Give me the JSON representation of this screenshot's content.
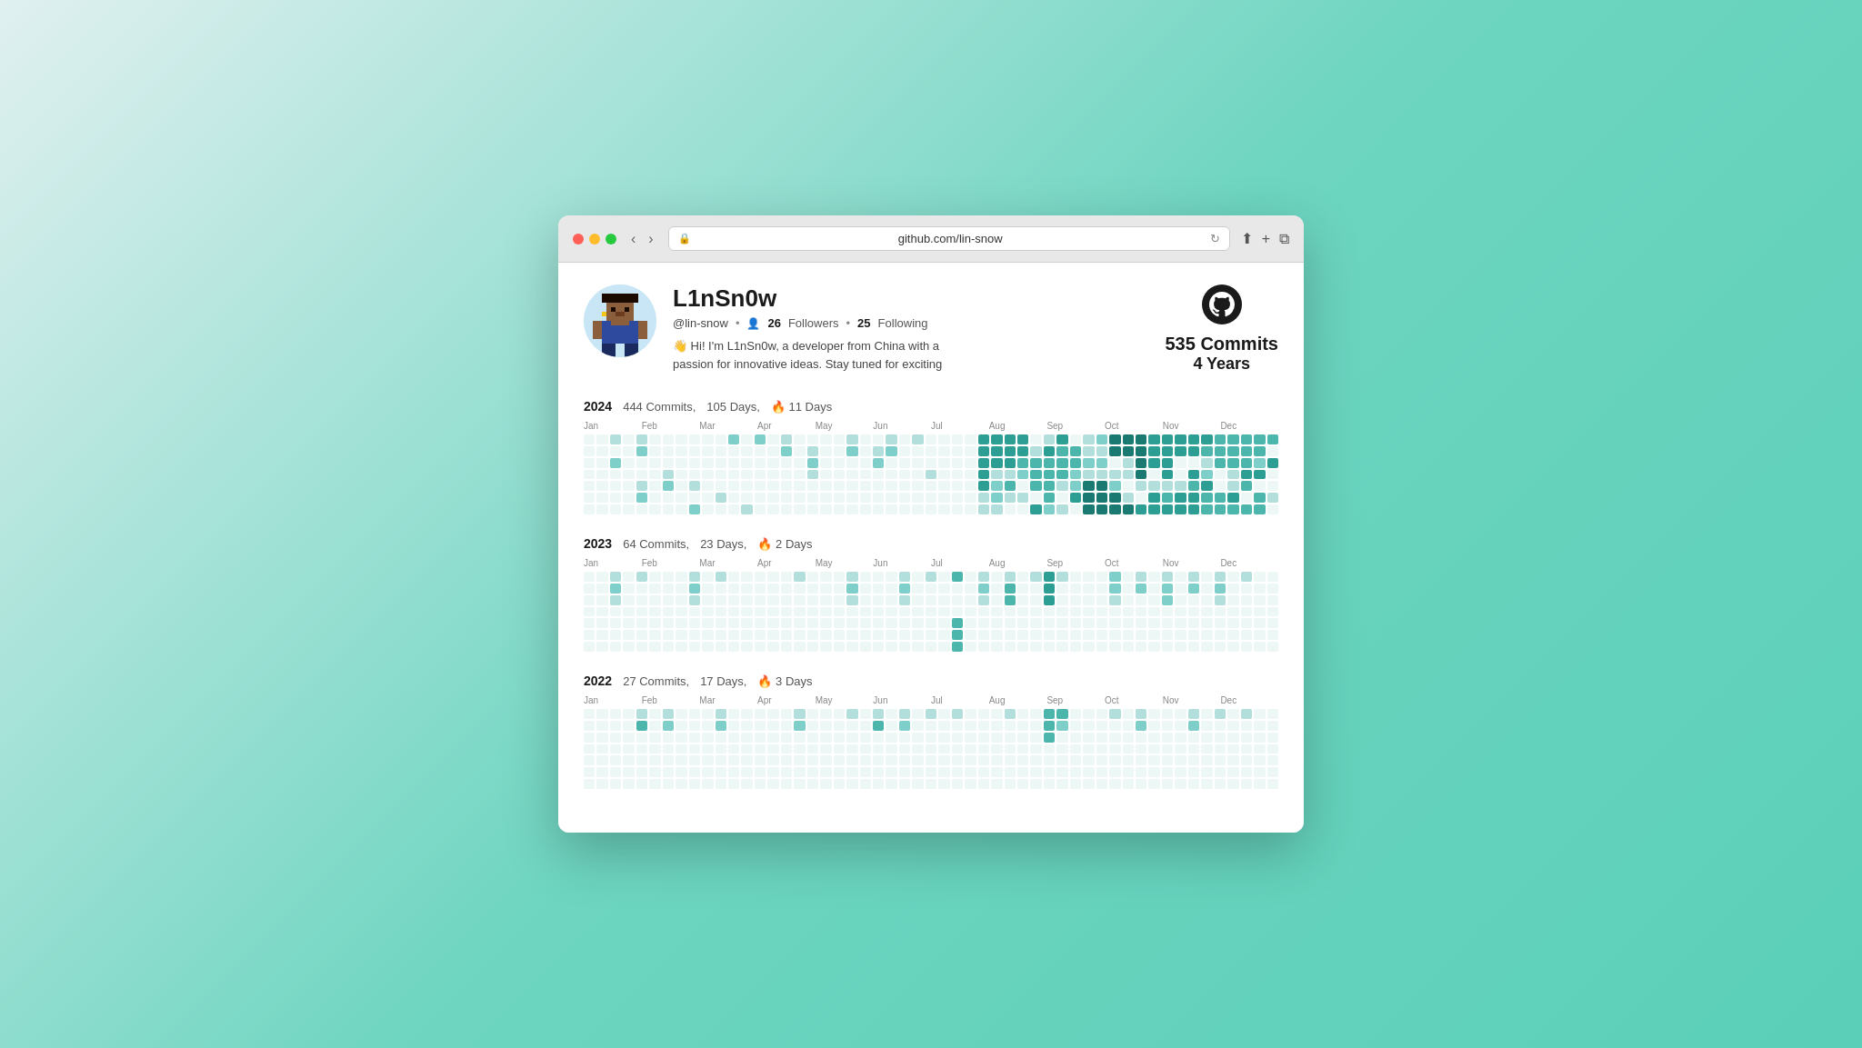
{
  "browser": {
    "url": "github.com/lin-snow",
    "back_label": "‹",
    "forward_label": "›"
  },
  "profile": {
    "name": "L1nSn0w",
    "handle": "@lin-snow",
    "followers_count": "26",
    "followers_label": "Followers",
    "following_count": "25",
    "following_label": "Following",
    "bio": "👋 Hi! I'm L1nSn0w, a developer from China with a passion for innovative ideas. Stay tuned for exciting",
    "total_commits": "535 Commits",
    "total_years": "4 Years"
  },
  "years": [
    {
      "year": "2024",
      "commits": "444 Commits,",
      "days": "105 Days,",
      "streak": "🔥 11 Days",
      "months": [
        "Jan",
        "Feb",
        "Mar",
        "Apr",
        "May",
        "Jun",
        "Jul",
        "Aug",
        "Sep",
        "Oct",
        "Nov",
        "Dec"
      ]
    },
    {
      "year": "2023",
      "commits": "64 Commits,",
      "days": "23 Days,",
      "streak": "🔥 2 Days",
      "months": [
        "Jan",
        "Feb",
        "Mar",
        "Apr",
        "May",
        "Jun",
        "Jul",
        "Aug",
        "Sep",
        "Oct",
        "Nov",
        "Dec"
      ]
    },
    {
      "year": "2022",
      "commits": "27 Commits,",
      "days": "17 Days,",
      "streak": "🔥 3 Days",
      "months": [
        "Jan",
        "Feb",
        "Mar",
        "Apr",
        "May",
        "Jun",
        "Jul",
        "Aug",
        "Sep",
        "Oct",
        "Nov",
        "Dec"
      ]
    }
  ]
}
